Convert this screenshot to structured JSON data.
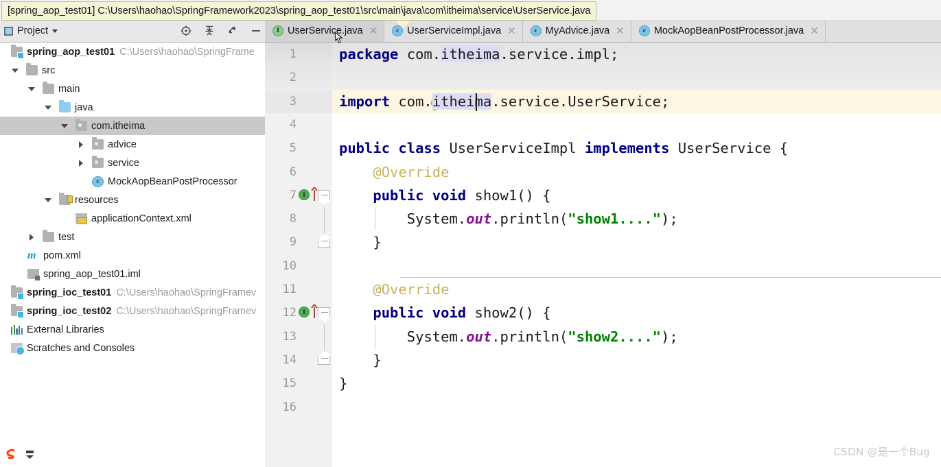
{
  "window": {
    "path_tooltip": "[spring_aop_test01] C:\\Users\\haohao\\SpringFramework2023\\spring_aop_test01\\src\\main\\java\\com\\itheima\\service\\UserService.java"
  },
  "project_panel": {
    "title": "Project",
    "toolbar": [
      {
        "name": "locate-icon",
        "tooltip": "Select Opened File"
      },
      {
        "name": "collapse-all-icon",
        "tooltip": "Collapse All"
      },
      {
        "name": "gear-icon",
        "tooltip": "Settings"
      },
      {
        "name": "hide-icon",
        "tooltip": "Hide"
      }
    ],
    "tree": [
      {
        "label": "spring_aop_test01",
        "path": "C:\\Users\\haohao\\SpringFrame",
        "icon": "module-folder-icon",
        "depth": 0,
        "arrow": "none",
        "bold": true,
        "selected": false
      },
      {
        "label": "src",
        "path": "",
        "icon": "folder-gray-icon",
        "depth": 1,
        "arrow": "down",
        "bold": false,
        "selected": false
      },
      {
        "label": "main",
        "path": "",
        "icon": "folder-gray-icon",
        "depth": 2,
        "arrow": "down",
        "bold": false,
        "selected": false
      },
      {
        "label": "java",
        "path": "",
        "icon": "folder-blue-icon",
        "depth": 3,
        "arrow": "down",
        "bold": false,
        "selected": false
      },
      {
        "label": "com.itheima",
        "path": "",
        "icon": "package-icon",
        "depth": 4,
        "arrow": "down",
        "bold": false,
        "selected": true
      },
      {
        "label": "advice",
        "path": "",
        "icon": "package-icon",
        "depth": 5,
        "arrow": "right",
        "bold": false,
        "selected": false
      },
      {
        "label": "service",
        "path": "",
        "icon": "package-icon",
        "depth": 5,
        "arrow": "right",
        "bold": false,
        "selected": false
      },
      {
        "label": "MockAopBeanPostProcessor",
        "path": "",
        "icon": "java-class-icon",
        "depth": 5,
        "arrow": "none",
        "bold": false,
        "selected": false
      },
      {
        "label": "resources",
        "path": "",
        "icon": "resources-folder-icon",
        "depth": 3,
        "arrow": "down",
        "bold": false,
        "selected": false
      },
      {
        "label": "applicationContext.xml",
        "path": "",
        "icon": "xml-file-icon",
        "depth": 4,
        "arrow": "none",
        "bold": false,
        "selected": false
      },
      {
        "label": "test",
        "path": "",
        "icon": "folder-gray-icon",
        "depth": 2,
        "arrow": "right",
        "bold": false,
        "selected": false
      },
      {
        "label": "pom.xml",
        "path": "",
        "icon": "maven-icon",
        "depth": 2,
        "arrow": "none",
        "bold": false,
        "selected": false
      },
      {
        "label": "spring_aop_test01.iml",
        "path": "",
        "icon": "iml-file-icon",
        "depth": 2,
        "arrow": "none",
        "bold": false,
        "selected": false
      },
      {
        "label": "spring_ioc_test01",
        "path": "C:\\Users\\haohao\\SpringFramev",
        "icon": "module-folder-icon",
        "depth": 0,
        "arrow": "none",
        "bold": true,
        "selected": false
      },
      {
        "label": "spring_ioc_test02",
        "path": "C:\\Users\\haohao\\SpringFramev",
        "icon": "module-folder-icon",
        "depth": 0,
        "arrow": "none",
        "bold": true,
        "selected": false
      },
      {
        "label": "External Libraries",
        "path": "",
        "icon": "external-libraries-icon",
        "depth": 0,
        "arrow": "none",
        "bold": false,
        "selected": false
      },
      {
        "label": "Scratches and Consoles",
        "path": "",
        "icon": "scratches-icon",
        "depth": 0,
        "arrow": "none",
        "bold": false,
        "selected": false
      }
    ]
  },
  "editor_tabs": [
    {
      "label": "UserService.java",
      "icon": "interface-icon",
      "icon_letter": "I",
      "active": true
    },
    {
      "label": "UserServiceImpl.java",
      "icon": "class-icon",
      "icon_letter": "c",
      "active": false
    },
    {
      "label": "MyAdvice.java",
      "icon": "class-icon",
      "icon_letter": "c",
      "active": false
    },
    {
      "label": "MockAopBeanPostProcessor.java",
      "icon": "class-icon",
      "icon_letter": "c",
      "active": false
    }
  ],
  "editor": {
    "caret_line": 3,
    "lines": [
      {
        "n": "1",
        "gutter": "none"
      },
      {
        "n": "2",
        "gutter": "bulb"
      },
      {
        "n": "3",
        "gutter": "none"
      },
      {
        "n": "4",
        "gutter": "none"
      },
      {
        "n": "5",
        "gutter": "none"
      },
      {
        "n": "6",
        "gutter": "none"
      },
      {
        "n": "7",
        "gutter": "implements"
      },
      {
        "n": "8",
        "gutter": "none"
      },
      {
        "n": "9",
        "gutter": "foldend"
      },
      {
        "n": "10",
        "gutter": "none"
      },
      {
        "n": "11",
        "gutter": "none"
      },
      {
        "n": "12",
        "gutter": "implements"
      },
      {
        "n": "13",
        "gutter": "none"
      },
      {
        "n": "14",
        "gutter": "foldend"
      },
      {
        "n": "15",
        "gutter": "none"
      },
      {
        "n": "16",
        "gutter": "none"
      }
    ],
    "source": {
      "l1_kw": "package",
      "l1_a": " com.",
      "l1_hl": "itheima",
      "l1_b": ".service.impl;",
      "l3_kw": "import",
      "l3_a": " com.",
      "l3_hl": "itheima",
      "l3_b": ".service.UserService;",
      "l5_kw1": "public class",
      "l5_name": " UserServiceImpl ",
      "l5_kw2": "implements",
      "l5_iface": " UserService {",
      "l6_ann": "    @Override",
      "l7_kw": "    public void",
      "l7_sig": " show1() {",
      "l8_a": "        System.",
      "l8_fld": "out",
      "l8_b": ".println(",
      "l8_str": "\"show1....\"",
      "l8_c": ");",
      "l9": "    }",
      "l11_ann": "    @Override",
      "l12_kw": "    public void",
      "l12_sig": " show2() {",
      "l13_a": "        System.",
      "l13_fld": "out",
      "l13_b": ".println(",
      "l13_str": "\"show2....\"",
      "l13_c": ");",
      "l14": "    }",
      "l15": "}"
    }
  },
  "status_bar": {
    "icons": [
      {
        "name": "scratch-s-icon"
      },
      {
        "name": "more-options-icon"
      }
    ]
  },
  "watermark": {
    "text": "CSDN @是一个Bug"
  },
  "colors": {
    "keyword": "#00007f",
    "string": "#008000",
    "annotation": "#c9b15a",
    "field": "#871094",
    "identifier_highlight": "#dcdcf7",
    "caret_line": "#fdf6e3",
    "tooltip_bg": "#f5f4d7",
    "selection": "#c9c9c9"
  }
}
